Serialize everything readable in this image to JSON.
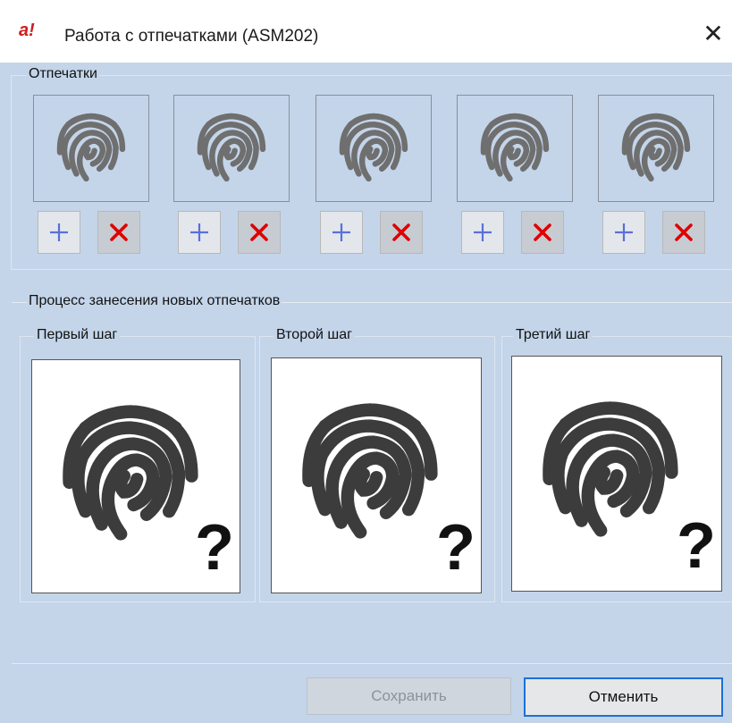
{
  "window": {
    "logo_text": "a!",
    "title": "Работа с отпечатками (ASM202)",
    "close_glyph": "✕"
  },
  "prints_group": {
    "label": "Отпечатки",
    "slots": [
      {
        "add_glyph": "+",
        "delete_glyph": "✕"
      },
      {
        "add_glyph": "+",
        "delete_glyph": "✕"
      },
      {
        "add_glyph": "+",
        "delete_glyph": "✕"
      },
      {
        "add_glyph": "+",
        "delete_glyph": "✕"
      },
      {
        "add_glyph": "+",
        "delete_glyph": "✕"
      }
    ]
  },
  "enroll_group": {
    "label": "Процесс занесения новых отпечатков",
    "steps": [
      {
        "label": "Первый шаг",
        "mark": "?"
      },
      {
        "label": "Второй шаг",
        "mark": "?"
      },
      {
        "label": "Третий шаг",
        "mark": "?"
      }
    ]
  },
  "footer": {
    "save_label": "Сохранить",
    "cancel_label": "Отменить"
  },
  "colors": {
    "background": "#c4d5ea",
    "add_icon": "#5b6fd8",
    "delete_icon": "#e00000",
    "fingerprint_small": "#6f6f6f",
    "fingerprint_large": "#3c3c3c",
    "logo": "#d01e1e",
    "focus_border": "#1d70d6"
  }
}
